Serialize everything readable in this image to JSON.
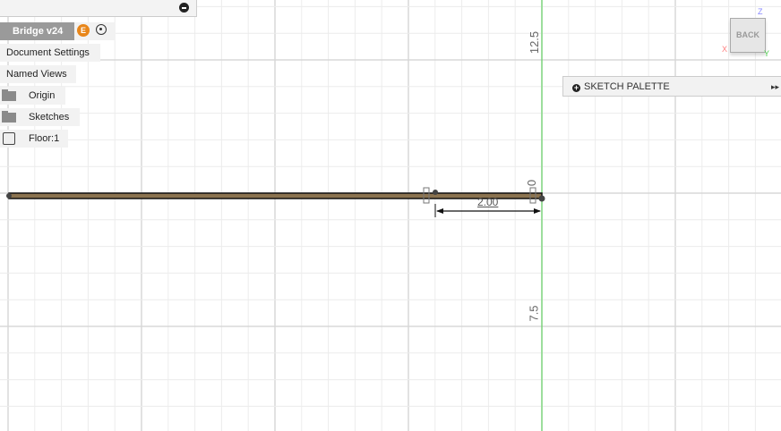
{
  "browser": {
    "title": "Bridge v24",
    "badge": "E",
    "items": [
      {
        "label": "Document Settings",
        "icon": "none"
      },
      {
        "label": "Named Views",
        "icon": "none"
      },
      {
        "label": "Origin",
        "icon": "folder-icon"
      },
      {
        "label": "Sketches",
        "icon": "folder-icon"
      },
      {
        "label": "Floor:1",
        "icon": "body-icon"
      }
    ]
  },
  "palette": {
    "label": "SKETCH PALETTE",
    "expand": "▸▸"
  },
  "viewcube": {
    "face": "BACK",
    "x": "X",
    "y": "Y",
    "z": "Z"
  },
  "canvas": {
    "ruler_labels": [
      "12.5",
      "0",
      "7.5"
    ],
    "dimension": "2.00"
  },
  "colors": {
    "beam": "#8b7350",
    "axis_green": "#4cd04c",
    "grid": "#e4e4e4",
    "badge": "#e8861a"
  }
}
